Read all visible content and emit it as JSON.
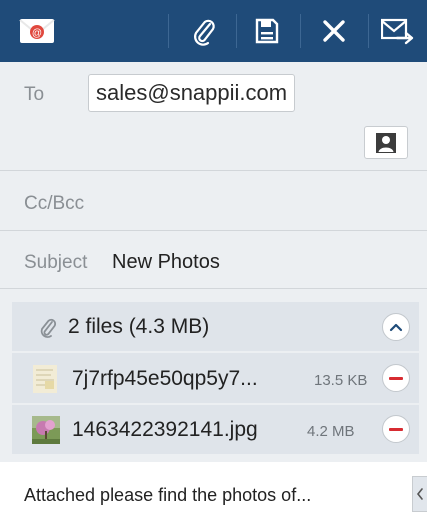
{
  "toolbar": {
    "icons": [
      "email-app-icon",
      "attach-icon",
      "save-draft-icon",
      "discard-icon",
      "send-icon"
    ]
  },
  "compose": {
    "to_label": "To",
    "to_recipient": "sales@snappii.com",
    "ccbcc_label": "Cc/Bcc",
    "subject_label": "Subject",
    "subject_value": "New Photos"
  },
  "attachments": {
    "summary": "2 files (4.3 MB)",
    "files": [
      {
        "name": "7j7rfp45e50qp5y7...",
        "size": "13.5 KB"
      },
      {
        "name": "1463422392141.jpg",
        "size": "4.2 MB"
      }
    ]
  },
  "body": {
    "text": "Attached please find the photos of..."
  },
  "colors": {
    "toolbar": "#1f4b79",
    "background": "#eceff2",
    "attachment_panel": "#dfe4ea",
    "remove_accent": "#d72b31"
  }
}
